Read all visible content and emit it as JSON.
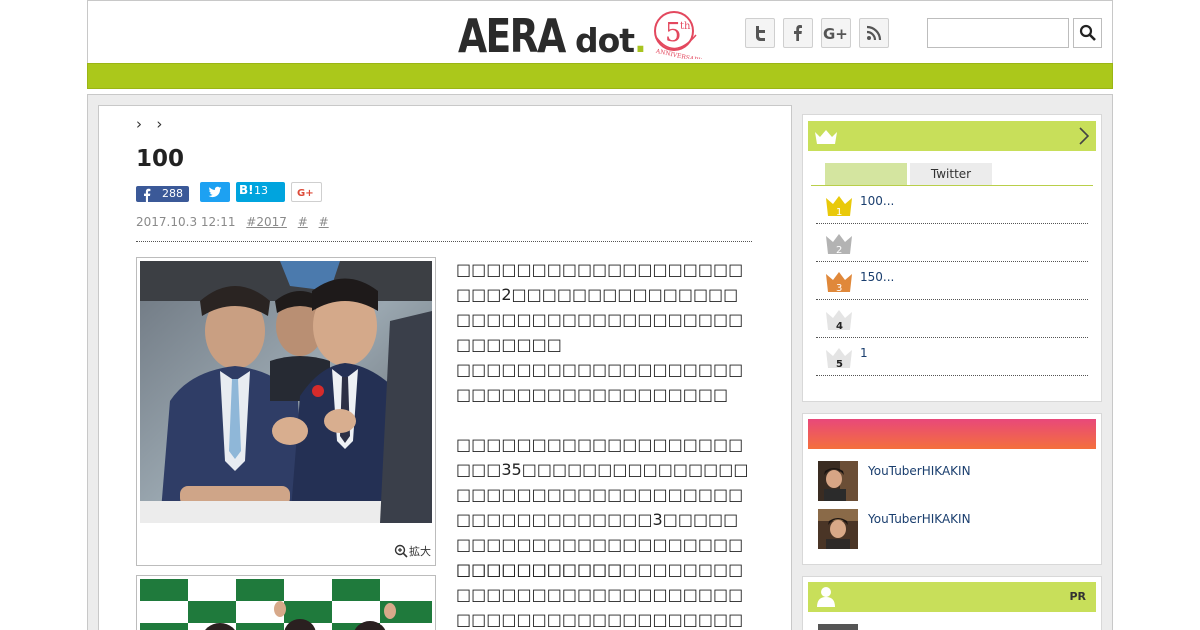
{
  "header": {
    "logo_main": "AERA",
    "logo_dot": "dot",
    "logo_badge_number": "5",
    "logo_badge_suffix": "th",
    "logo_badge_text": "ANNIVERSARY",
    "social_icons": [
      "twitter-icon",
      "facebook-icon",
      "google-plus-icon",
      "rss-icon"
    ],
    "search_placeholder": ""
  },
  "article": {
    "breadcrumb_separators": [
      "›",
      "›"
    ],
    "title": "100",
    "share": {
      "facebook_count": "288",
      "hatena_label": "B!",
      "hatena_count": "13"
    },
    "date": "2017.10.3 12:11",
    "tags": [
      "#2017",
      "#",
      "#"
    ],
    "photo_zoom_label": "拡大",
    "paragraphs": [
      "□□□□□□□□□□□□□□□□□□□□□□2□□□□□□□□□□□□□□□□□□□□□□□□□□□□□□□□□□□□□□□□□",
      "□□□□□□□□□□□□□□□□□□□□□□□□□□□□□□□□□□□□□",
      "□□□□□□□□□□□□□□□□□□□□□□35□□□□□□□□□□□□□□□□□□□□□□□□□□□□□□□□□□□□□□□□□□□□□□□3□□□□□□□□□□□□□□□□□□□□□□□□□□□□□□□□□□□",
      "□□□□□□□□□□□□□□□□□□□□□□□□□□□□□□□□□□□□□□□□□□□□□□□□□□□□□□□□□□□□□□□□□□□□□□□□□"
    ]
  },
  "sidebar": {
    "ranking": {
      "tabs": [
        "",
        "Twitter"
      ],
      "items": [
        {
          "rank": "1",
          "text": "100..."
        },
        {
          "rank": "2",
          "text": ""
        },
        {
          "rank": "3",
          "text": "150..."
        },
        {
          "rank": "4",
          "text": ""
        },
        {
          "rank": "5",
          "text": "1"
        }
      ]
    },
    "featured": {
      "items": [
        {
          "text": "YouTuberHIKAKIN"
        },
        {
          "text": "YouTuberHIKAKIN"
        }
      ]
    },
    "pr_label": "PR"
  },
  "colors": {
    "accent_green": "#abc81b",
    "sidebar_green": "#c8df5a",
    "gradient_start": "#e8487a",
    "gradient_end": "#f46f3c",
    "link": "#1a3e6e"
  }
}
